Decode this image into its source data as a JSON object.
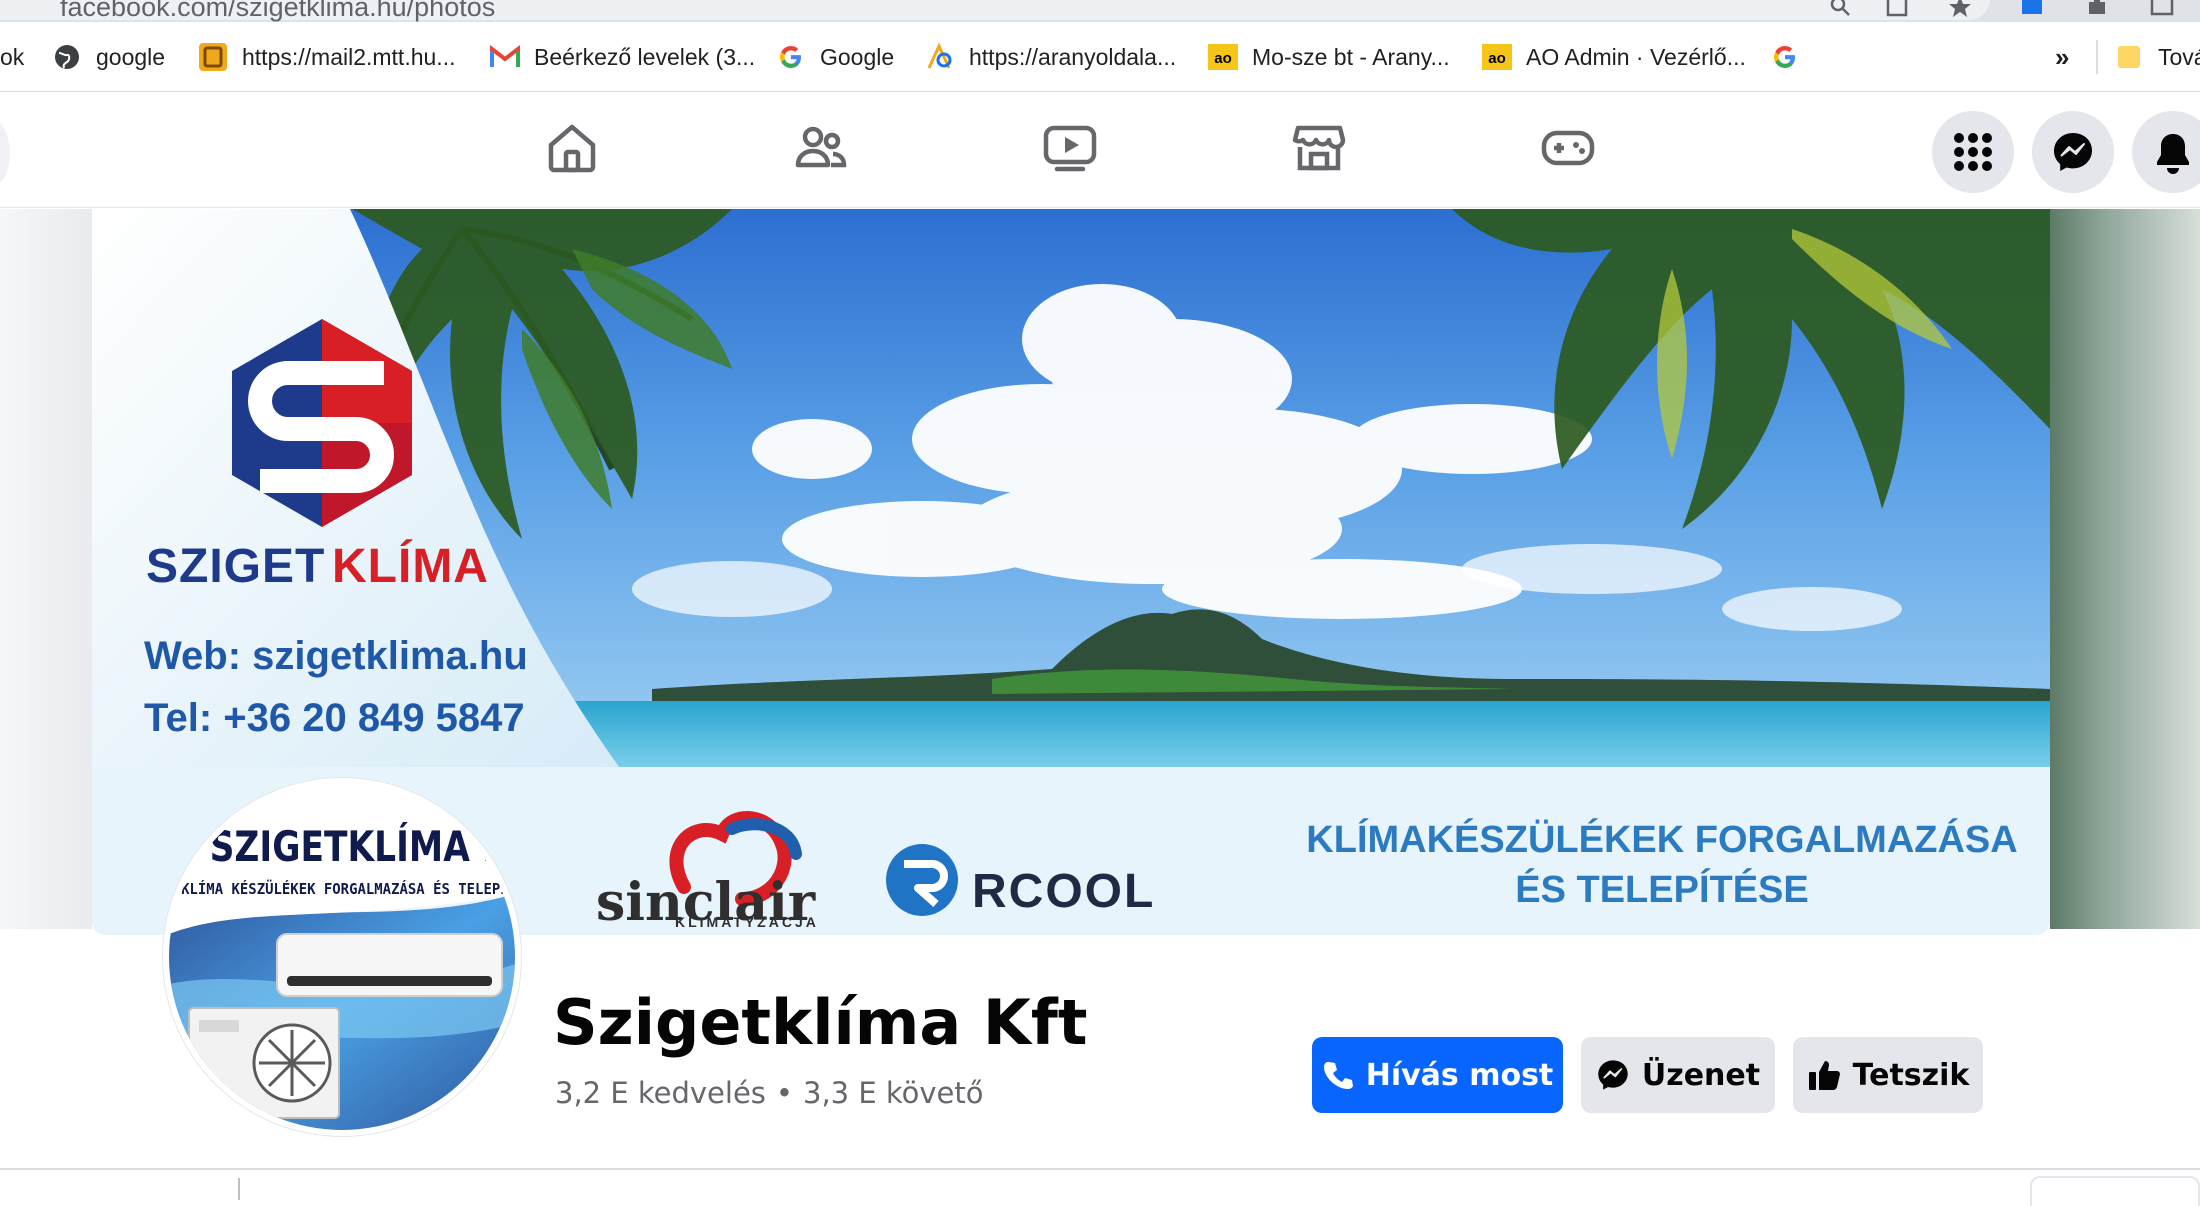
{
  "browser": {
    "url": "facebook.com/szigetklima.hu/photos",
    "bookmarks": [
      {
        "label": "ok",
        "icon": "none"
      },
      {
        "label": "google",
        "icon": "globe-icon"
      },
      {
        "label": "https://mail2.mtt.hu...",
        "icon": "mail-favicon"
      },
      {
        "label": "Beérkező levelek (3...",
        "icon": "gmail-icon"
      },
      {
        "label": "Google",
        "icon": "google-icon"
      },
      {
        "label": "https://aranyoldala...",
        "icon": "aranyoldalak-icon"
      },
      {
        "label": "Mo-sze bt - Arany...",
        "icon": "ao-icon"
      },
      {
        "label": "AO Admin · Vezérlő...",
        "icon": "ao-icon"
      },
      {
        "label": "",
        "icon": "google-icon"
      }
    ],
    "overflow_label": "»",
    "other_bookmarks_label": "Tová"
  },
  "nav": {
    "tabs": [
      "home-icon",
      "friends-icon",
      "watch-icon",
      "marketplace-icon",
      "gaming-icon"
    ],
    "right": [
      "menu-grid-icon",
      "messenger-icon",
      "notifications-icon"
    ]
  },
  "cover": {
    "brand_part1": "SZIGET",
    "brand_part2": "KLÍMA",
    "web": "Web: szigetklima.hu",
    "tel": "Tel: +36 20 849 5847",
    "tagline_line1": "KLÍMAKÉSZÜLÉKEK FORGALMAZÁSA",
    "tagline_line2": "ÉS TELEPÍTÉSE",
    "sinclair": "sinclair",
    "sinclair_sub": "KLIMATYZACJA",
    "rcool": "RCOOL"
  },
  "avatar": {
    "title": "SZIGETKLÍMA KFT.",
    "subtitle": "KLÍMA KÉSZÜLÉKEK FORGALMAZÁSA ÉS TELEPÍTÉSE"
  },
  "page": {
    "name": "Szigetklíma Kft",
    "likes": "3,2 E kedvelés",
    "separator": "•",
    "followers": "3,3 E követő"
  },
  "actions": {
    "call": "Hívás most",
    "message": "Üzenet",
    "like": "Tetszik"
  },
  "colors": {
    "facebook_blue": "#0866ff",
    "button_grey": "#e4e6eb",
    "brand_red": "#d81f26",
    "brand_blue": "#1e3a8a"
  }
}
